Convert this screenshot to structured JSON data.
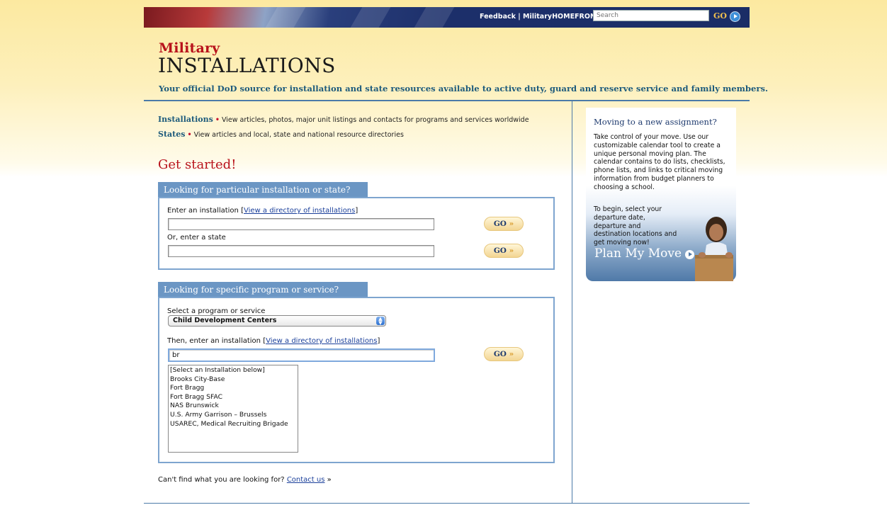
{
  "topbar": {
    "links": "Feedback | MilitaryHOMEFRONT |",
    "search_placeholder": "Search",
    "go_label": "GO"
  },
  "header": {
    "logo_top": "Military",
    "logo_main": "INSTALLATIONS",
    "tagline": "Your official DoD source for installation and state resources available to active duty, guard and reserve service and family members."
  },
  "intro": {
    "installations_label": "Installations",
    "installations_text": "View articles, photos, major unit listings and contacts for programs and services worldwide",
    "states_label": "States",
    "states_text": "View articles and local, state and national resource directories",
    "bullet": "•"
  },
  "get_started": "Get started!",
  "panel1": {
    "tab": "Looking for particular installation or state?",
    "enter_installation_label": "Enter an installation",
    "directory_link": "View a directory of installations",
    "installation_value": "",
    "or_state_label": "Or, enter a state",
    "state_value": "",
    "go_label": "GO",
    "go_arrow": "»"
  },
  "panel2": {
    "tab": "Looking for specific program or service?",
    "select_label": "Select a program or service",
    "selected_program": "Child Development Centers",
    "then_label": "Then, enter an installation",
    "directory_link": "View a directory of installations",
    "installation_value": "br",
    "go_label": "GO",
    "go_arrow": "»",
    "suggestions": [
      "[Select an Installation below]",
      "Brooks City-Base",
      "Fort Bragg",
      "Fort Bragg SFAC",
      "NAS Brunswick",
      "U.S. Army Garrison – Brussels",
      "USAREC, Medical Recruiting Brigade"
    ]
  },
  "cant_find": {
    "text": "Can't find what you are looking for?",
    "link": "Contact us",
    "arrow": "»"
  },
  "promo": {
    "title": "Moving to a new assignment?",
    "text": "Take control of your move. Use our customizable calendar tool to create a unique personal moving plan. The calendar contains to do lists, checklists, phone lists, and links to critical moving information from budget planners to choosing a school.",
    "text2": "To begin, select your departure date, departure and destination locations and get moving now!",
    "cta": "Plan My Move"
  },
  "colors": {
    "brand_red": "#b8121b",
    "brand_blue": "#1e5b7c",
    "tab_blue": "#6b96c4",
    "go_gold": "#f3d592"
  }
}
